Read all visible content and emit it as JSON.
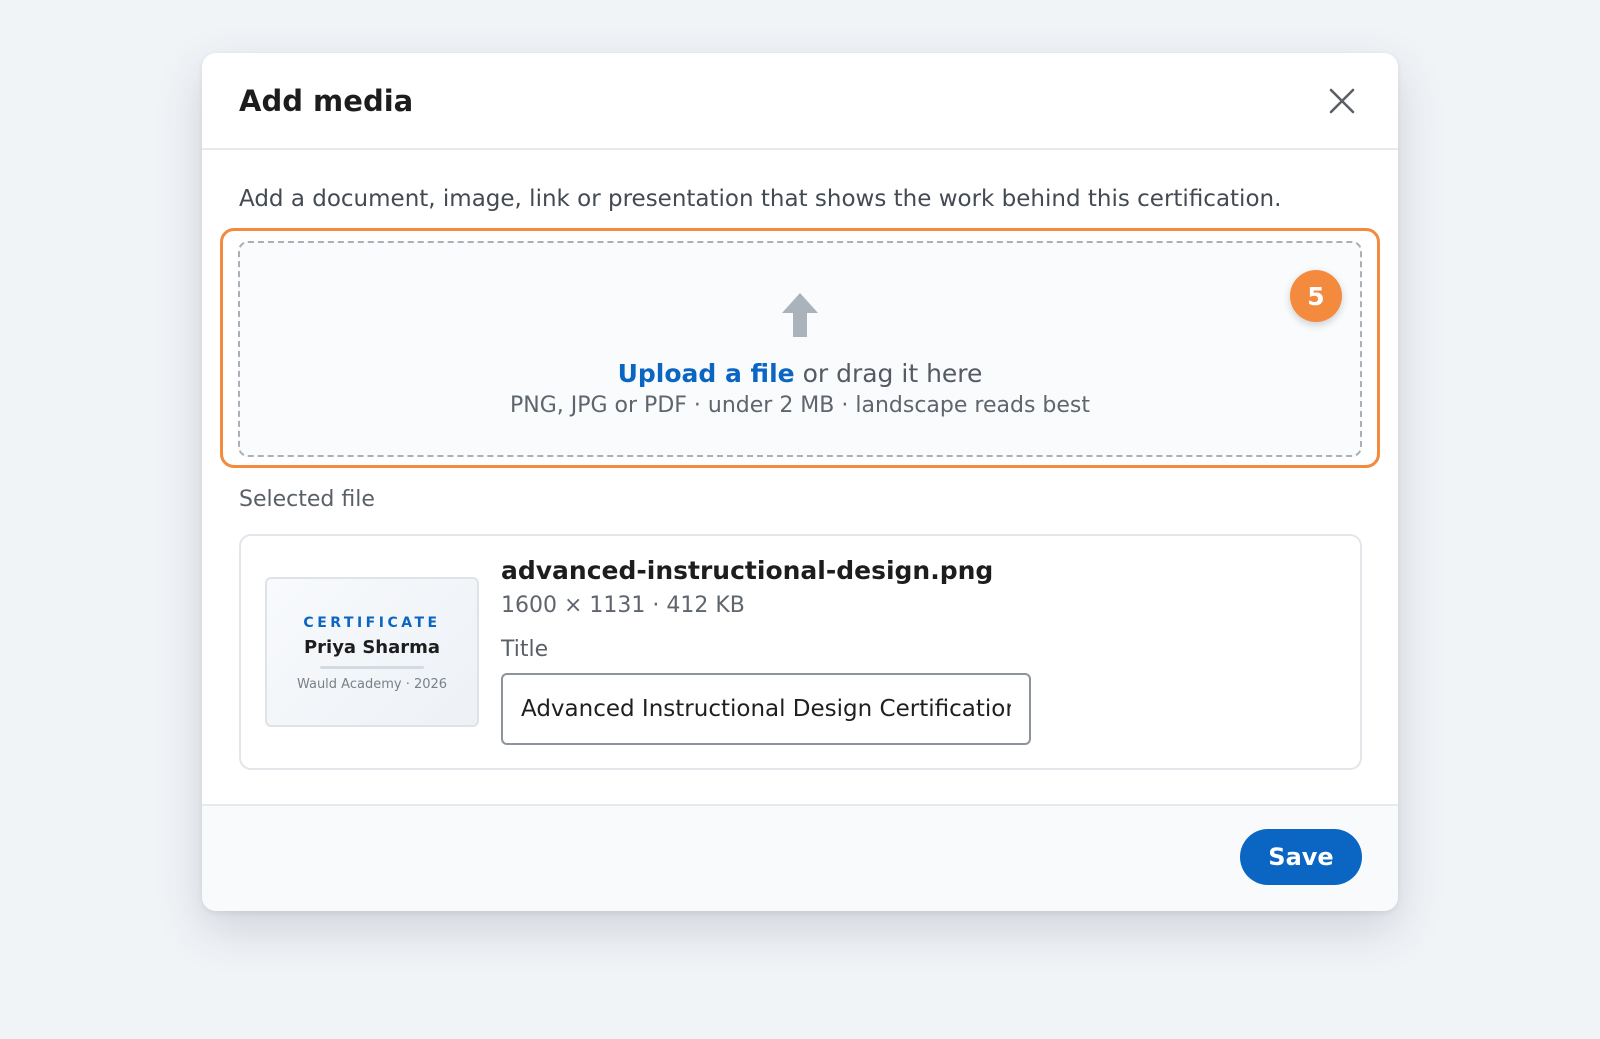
{
  "modal": {
    "title": "Add media",
    "close_icon": "close-icon",
    "intro": "Add a document, image, link or presentation that shows the work behind this certification."
  },
  "dropzone": {
    "upload_icon": "upload-arrow-icon",
    "upload_link": "Upload a file",
    "drag_text": " or drag it here",
    "hint": "PNG, JPG or PDF · under 2 MB · landscape reads best",
    "step_badge": "5"
  },
  "selected": {
    "section_label": "Selected file",
    "thumbnail": {
      "kicker": "CERTIFICATE",
      "name": "Priya Sharma",
      "footer": "Wauld Academy · 2026"
    },
    "file_name": "advanced-instructional-design.png",
    "file_meta": "1600 × 1131 · 412 KB",
    "title_label": "Title",
    "title_value": "Advanced Instructional Design Certification"
  },
  "footer": {
    "save_label": "Save"
  },
  "colors": {
    "accent": "#0a66c2",
    "highlight": "#f38a3d"
  }
}
